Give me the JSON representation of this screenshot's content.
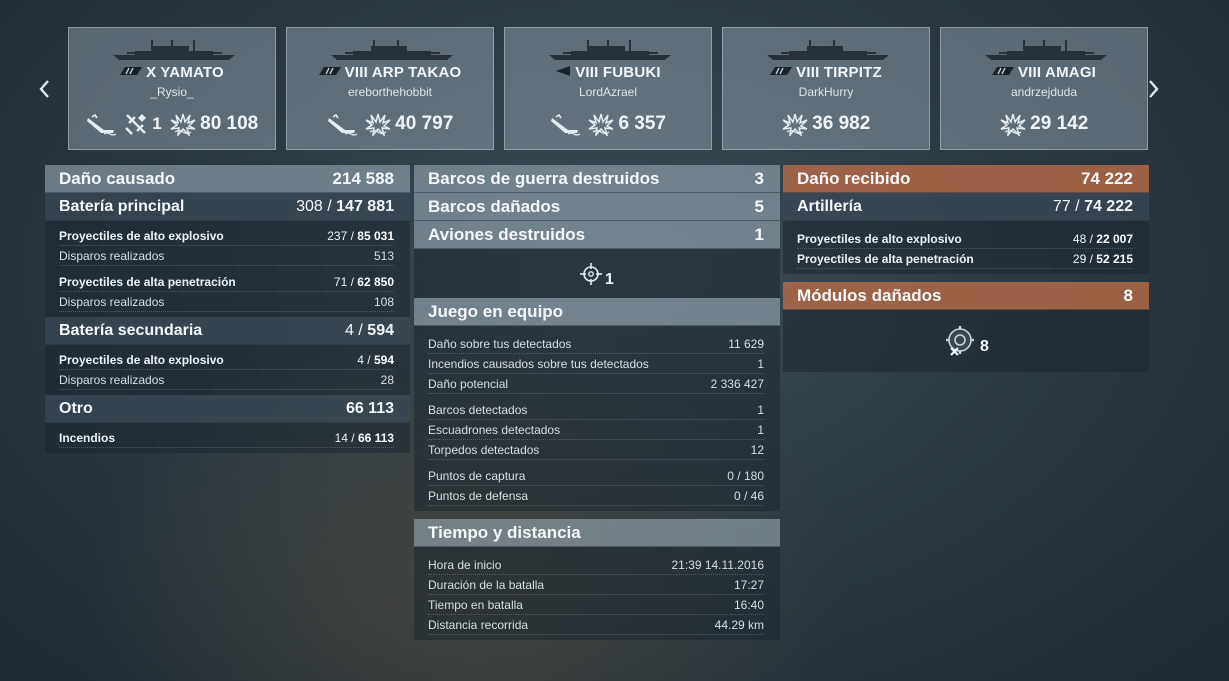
{
  "nav": {
    "prev_icon": "chevron-left-icon",
    "next_icon": "chevron-right-icon"
  },
  "cards": [
    {
      "class_icon": "battleship-class-icon",
      "name": "X YAMATO",
      "player": "_Rysio_",
      "badges": [
        {
          "icon": "sunk-ship-icon",
          "value": ""
        },
        {
          "icon": "plane-shot-icon",
          "value": "1"
        },
        {
          "icon": "damage-burst-icon",
          "value": "80 108"
        }
      ]
    },
    {
      "class_icon": "cruiser-class-icon",
      "name": "VIII ARP TAKAO",
      "player": "ereborthehobbit",
      "badges": [
        {
          "icon": "sunk-ship-icon",
          "value": ""
        },
        {
          "icon": "damage-burst-icon",
          "value": "40 797"
        }
      ]
    },
    {
      "class_icon": "destroyer-class-icon",
      "name": "VIII FUBUKI",
      "player": "LordAzrael",
      "badges": [
        {
          "icon": "sunk-ship-icon",
          "value": ""
        },
        {
          "icon": "damage-burst-icon",
          "value": "6 357"
        }
      ]
    },
    {
      "class_icon": "battleship-class-icon",
      "name": "VIII TIRPITZ",
      "player": "DarkHurry",
      "badges": [
        {
          "icon": "damage-burst-icon",
          "value": "36 982"
        }
      ]
    },
    {
      "class_icon": "battleship-class-icon",
      "name": "VIII AMAGI",
      "player": "andrzejduda",
      "badges": [
        {
          "icon": "damage-burst-icon",
          "value": "29 142"
        }
      ]
    }
  ],
  "left": {
    "damage": {
      "label": "Daño causado",
      "value": "214 588"
    },
    "main_battery": {
      "label": "Batería principal",
      "hits": "308",
      "value": "147 881",
      "rows": [
        {
          "label": "Proyectiles de alto explosivo",
          "hits": "237",
          "value": "85 031",
          "bold": true
        },
        {
          "label": "Disparos realizados",
          "value": "513",
          "bold": false
        },
        {
          "label": "Proyectiles de alta penetración",
          "hits": "71",
          "value": "62 850",
          "bold": true
        },
        {
          "label": "Disparos realizados",
          "value": "108",
          "bold": false
        }
      ]
    },
    "secondary": {
      "label": "Batería secundaria",
      "hits": "4",
      "value": "594",
      "rows": [
        {
          "label": "Proyectiles de alto explosivo",
          "hits": "4",
          "value": "594",
          "bold": true
        },
        {
          "label": "Disparos realizados",
          "value": "28",
          "bold": false
        }
      ]
    },
    "other": {
      "label": "Otro",
      "value": "66 113",
      "rows": [
        {
          "label": "Incendios",
          "hits": "14",
          "value": "66 113",
          "bold": true
        }
      ]
    }
  },
  "middle": {
    "ships_destroyed": {
      "label": "Barcos de guerra destruidos",
      "value": "3"
    },
    "ships_damaged": {
      "label": "Barcos dañados",
      "value": "5"
    },
    "planes_destroyed": {
      "label": "Aviones destruidos",
      "value": "1",
      "icon": "crosshair-icon",
      "icon_value": "1"
    },
    "teamwork": {
      "label": "Juego en equipo",
      "groups": [
        [
          {
            "label": "Daño sobre tus detectados",
            "value": "11 629"
          },
          {
            "label": "Incendios causados sobre tus detectados",
            "value": "1"
          },
          {
            "label": "Daño potencial",
            "value": "2 336 427"
          }
        ],
        [
          {
            "label": "Barcos detectados",
            "value": "1"
          },
          {
            "label": "Escuadrones detectados",
            "value": "1"
          },
          {
            "label": "Torpedos detectados",
            "value": "12"
          }
        ],
        [
          {
            "label": "Puntos de captura",
            "value": "0 / 180"
          },
          {
            "label": "Puntos de defensa",
            "value": "0 / 46"
          }
        ]
      ]
    },
    "time": {
      "label": "Tiempo y distancia",
      "rows": [
        {
          "label": "Hora de inicio",
          "value": "21:39  14.11.2016"
        },
        {
          "label": "Duración de la batalla",
          "value": "17:27"
        },
        {
          "label": "Tiempo en batalla",
          "value": "16:40"
        },
        {
          "label": "Distancia recorrida",
          "value": "44.29 km"
        }
      ]
    }
  },
  "right": {
    "received": {
      "label": "Daño recibido",
      "value": "74 222"
    },
    "artillery": {
      "label": "Artillería",
      "hits": "77",
      "value": "74 222",
      "rows": [
        {
          "label": "Proyectiles de alto explosivo",
          "hits": "48",
          "value": "22 007"
        },
        {
          "label": "Proyectiles de alta penetración",
          "hits": "29",
          "value": "52 215"
        }
      ]
    },
    "modules": {
      "label": "Módulos dañados",
      "value": "8",
      "icon": "damaged-module-icon",
      "icon_value": "8"
    }
  },
  "colors": {
    "header_grey": "#96a6b2",
    "header_orange": "#b0684a",
    "text": "#e8eef2"
  }
}
